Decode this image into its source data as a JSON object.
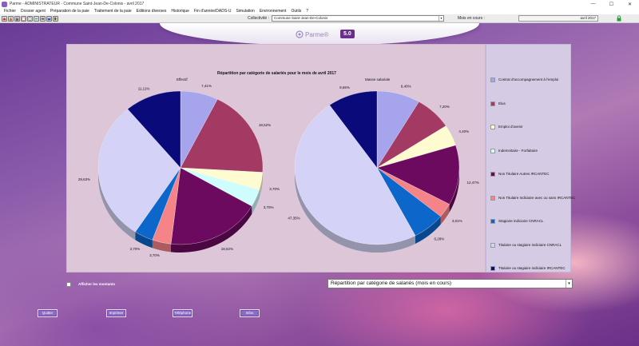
{
  "window": {
    "title": "Parme - ADMINISTRATEUR - Commune Saint-Jean-De-Colonis - avril 2017",
    "controls": [
      "—",
      "☐",
      "✕"
    ]
  },
  "menu": [
    "Fichier",
    "Dossier agent",
    "Préparation de la paie",
    "Traitement de la paie",
    "Editions diverses",
    "Historique",
    "Fin d'année/DADS-U",
    "Simulation",
    "Environnement",
    "Outils",
    "?"
  ],
  "toolbar": {
    "collectivite_label": "Collectivité :",
    "collectivite_value": "Commune Saint-Jean-De-Colonis",
    "mois_label": "Mois en cours :",
    "mois_value": "avril 2017"
  },
  "brand": {
    "name": "Parme®",
    "version": "5.0"
  },
  "chart": {
    "title": "Répartition par catégorie de salariés pour le mois de avril 2017"
  },
  "chart_data": [
    {
      "type": "pie",
      "title": "Effectif",
      "categories": [
        "Contrat d'accompagnement à l'emploi",
        "Elus",
        "Emploi d'avenir",
        "Indemnitaire - Forfaitaire",
        "Non Titulaire Autres IRCANTEC",
        "Non Titulaire Indiciaire avec ou sans IRCANTEC",
        "Stagiaire indiciaire CNRACL",
        "Titulaire ou stagiaire indiciaire CNRACL",
        "Titulaire ou stagiaire indiciaire IRCANTEC"
      ],
      "values": [
        7.41,
        18.52,
        3.7,
        3.7,
        18.52,
        3.7,
        3.7,
        29.63,
        11.11
      ],
      "labels": [
        "7,41%",
        "18,52%",
        "3,70%",
        "3,70%",
        "18,52%",
        "3,70%",
        "3,70%",
        "29,63%",
        "11,11%"
      ]
    },
    {
      "type": "pie",
      "title": "Masse salariale",
      "categories": [
        "Contrat d'accompagnement à l'emploi",
        "Elus",
        "Emploi d'avenir",
        "Indemnitaire - Forfaitaire",
        "Non Titulaire Autres IRCANTEC",
        "Non Titulaire Indiciaire avec ou sans IRCANTEC",
        "Stagiaire indiciaire CNRACL",
        "Titulaire ou stagiaire indiciaire CNRACL",
        "Titulaire ou stagiaire indiciaire IRCANTEC"
      ],
      "values": [
        8.4,
        7.2,
        4.4,
        0,
        12.47,
        3.01,
        6.28,
        47.35,
        9.65
      ],
      "labels": [
        "8,40%",
        "7,20%",
        "4,40%",
        "",
        "12,47%",
        "3,01%",
        "6,28%",
        "47,35%",
        "9,65%"
      ]
    }
  ],
  "legend": [
    {
      "label": "Contrat d'accompagnement à l'emploi",
      "color": "#a7a4ee"
    },
    {
      "label": "Elus",
      "color": "#a23a63"
    },
    {
      "label": "Emploi d'avenir",
      "color": "#fffbd0"
    },
    {
      "label": "Indemnitaire - Forfaitaire",
      "color": "#cffcfd"
    },
    {
      "label": "Non Titulaire Autres IRCANTEC",
      "color": "#6b0a5e"
    },
    {
      "label": "Non Titulaire Indiciaire avec ou sans IRCANTEC",
      "color": "#f58489"
    },
    {
      "label": "Stagiaire indiciaire CNRACL",
      "color": "#0d66c9"
    },
    {
      "label": "Titulaire ou stagiaire indiciaire CNRACL",
      "color": "#d4d2f6"
    },
    {
      "label": "Titulaire ou stagiaire indiciaire IRCANTEC",
      "color": "#0b0a7b"
    }
  ],
  "options": {
    "show_amounts_label": "Afficher les montants",
    "view_select_value": "Répartition par catégorie de salariés (mois en cours)"
  },
  "buttons": [
    "Quitter",
    "Imprimer",
    "Téléphone",
    "Infos"
  ]
}
